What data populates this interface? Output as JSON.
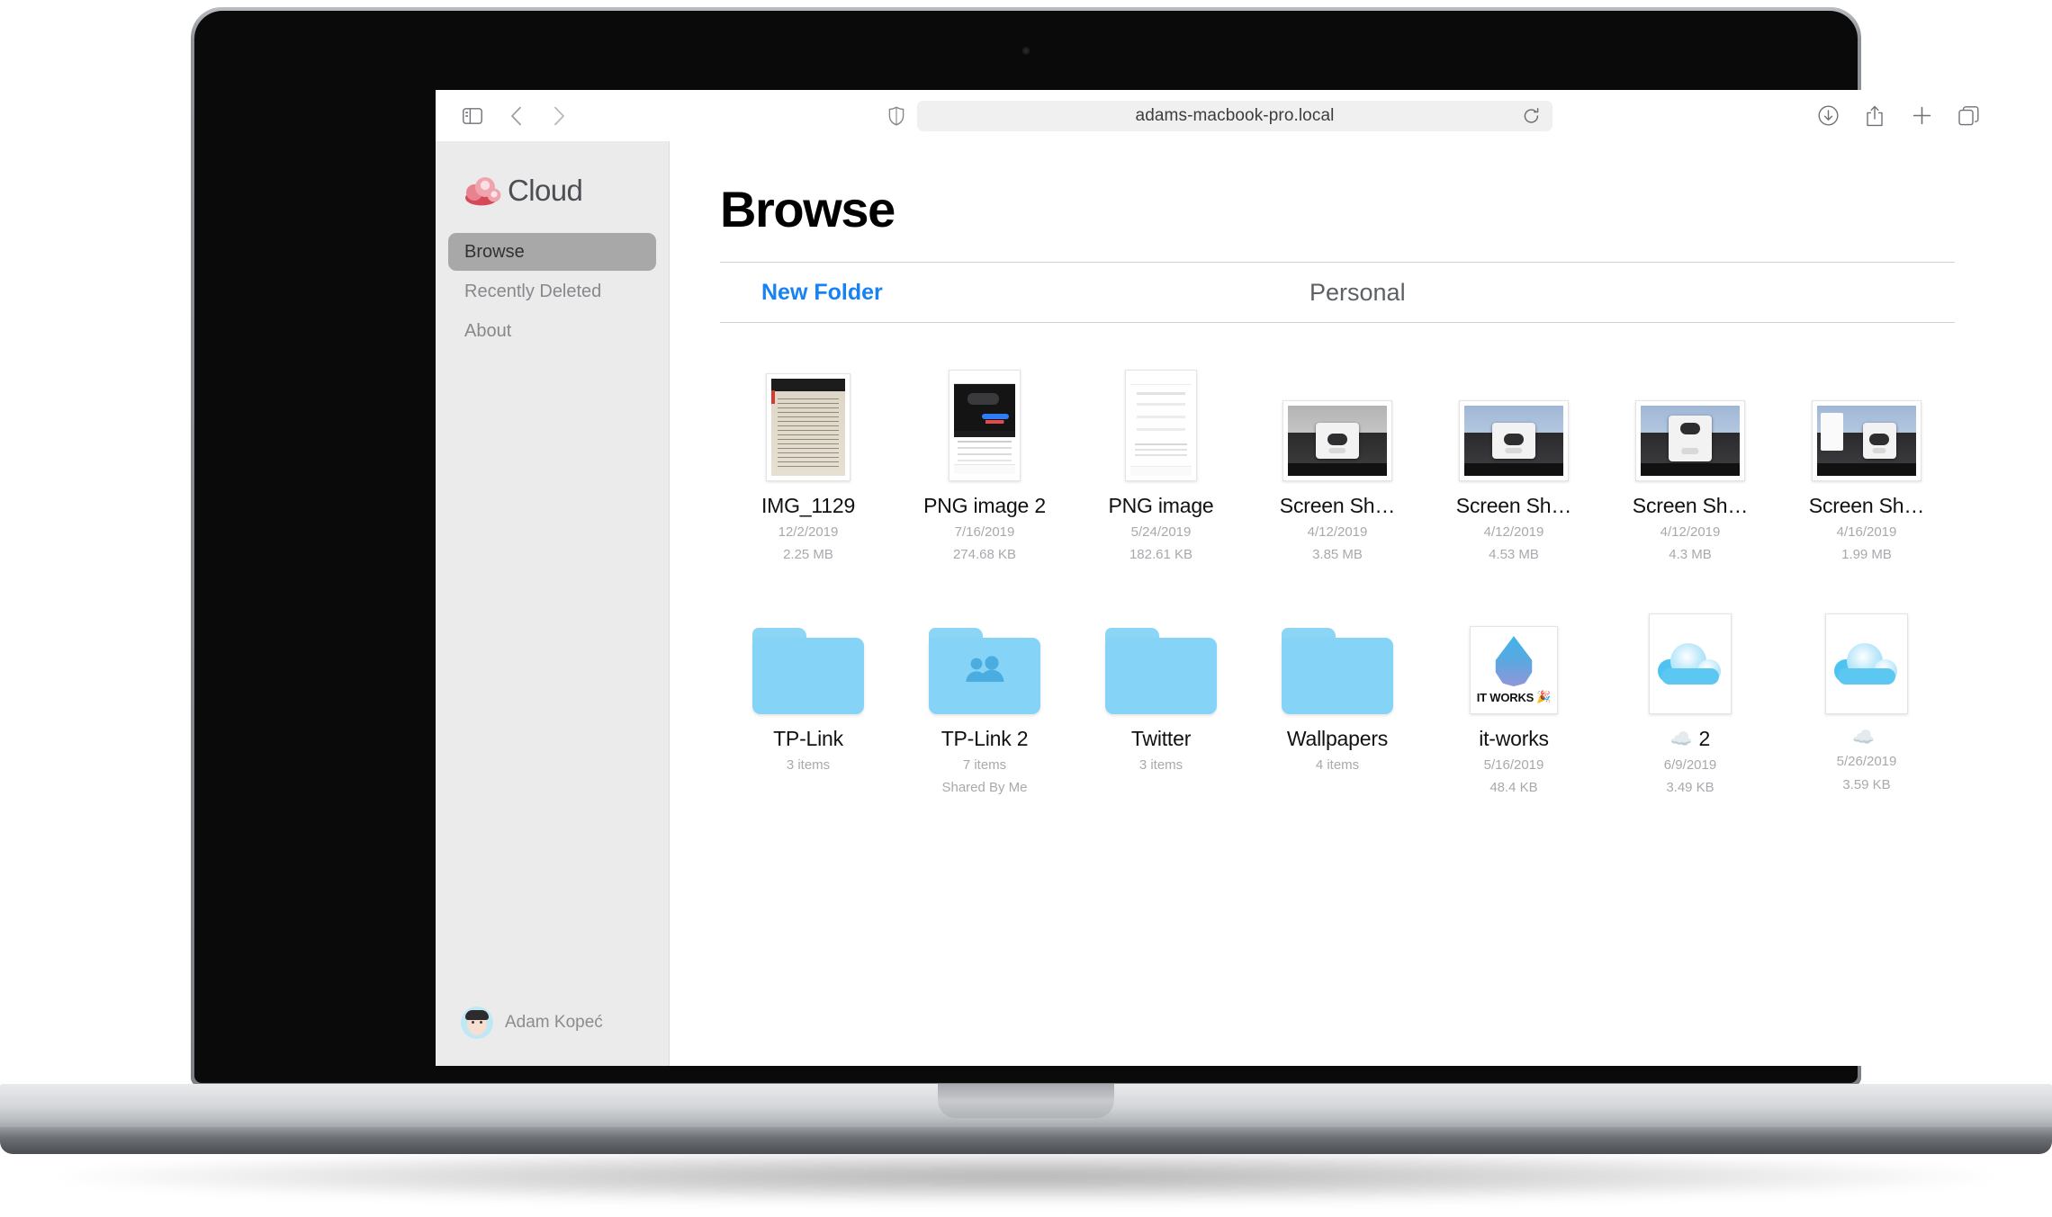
{
  "device": {
    "label": "MacBook Pro"
  },
  "browser": {
    "url": "adams-macbook-pro.local",
    "icons": {
      "sidebar_toggle": "sidebar-toggle-icon",
      "back": "chevron-left-icon",
      "forward": "chevron-right-icon",
      "shield": "shield-icon",
      "reload": "reload-icon",
      "downloads": "download-circle-icon",
      "share": "share-icon",
      "new_tab": "plus-icon",
      "tab_overview": "tabs-icon"
    }
  },
  "sidebar": {
    "brand": "Cloud",
    "brand_logo": "cloud-logo-icon",
    "items": [
      {
        "label": "Browse",
        "active": true
      },
      {
        "label": "Recently Deleted",
        "active": false
      },
      {
        "label": "About",
        "active": false
      }
    ],
    "user": {
      "name": "Adam Kopeć",
      "avatar": "memoji-avatar"
    }
  },
  "main": {
    "title": "Browse",
    "new_folder_label": "New Folder",
    "scope_label": "Personal",
    "accent_color": "#1782f3",
    "items": [
      {
        "name": "IMG_1129",
        "date": "12/2/2019",
        "size": "2.25 MB",
        "kind": "doc-scan"
      },
      {
        "name": "PNG image 2",
        "date": "7/16/2019",
        "size": "274.68 KB",
        "kind": "phone-dark"
      },
      {
        "name": "PNG image",
        "date": "5/24/2019",
        "size": "182.61 KB",
        "kind": "phone-light"
      },
      {
        "name": "Screen Sh…",
        "date": "4/12/2019",
        "size": "3.85 MB",
        "kind": "screenshot-gray"
      },
      {
        "name": "Screen Sh…",
        "date": "4/12/2019",
        "size": "4.53 MB",
        "kind": "screenshot"
      },
      {
        "name": "Screen Sh…",
        "date": "4/12/2019",
        "size": "4.3 MB",
        "kind": "screenshot-dialog"
      },
      {
        "name": "Screen Sh…",
        "date": "4/16/2019",
        "size": "1.99 MB",
        "kind": "screenshot-red"
      },
      {
        "name": "TP-Link",
        "date": "3 items",
        "size": "",
        "kind": "folder"
      },
      {
        "name": "TP-Link 2",
        "date": "7 items",
        "size": "Shared By Me",
        "kind": "folder-shared"
      },
      {
        "name": "Twitter",
        "date": "3 items",
        "size": "",
        "kind": "folder"
      },
      {
        "name": "Wallpapers",
        "date": "4 items",
        "size": "",
        "kind": "folder"
      },
      {
        "name": "it-works",
        "date": "5/16/2019",
        "size": "48.4 KB",
        "kind": "app-icon",
        "icon_text": "IT WORKS",
        "icon_emoji": "🎉"
      },
      {
        "name": "2",
        "date": "6/9/2019",
        "size": "3.49 KB",
        "kind": "cloud-png",
        "name_emoji": "☁️"
      },
      {
        "name": "",
        "date": "5/26/2019",
        "size": "3.59 KB",
        "kind": "cloud-png",
        "name_emoji": "☁️"
      }
    ]
  }
}
